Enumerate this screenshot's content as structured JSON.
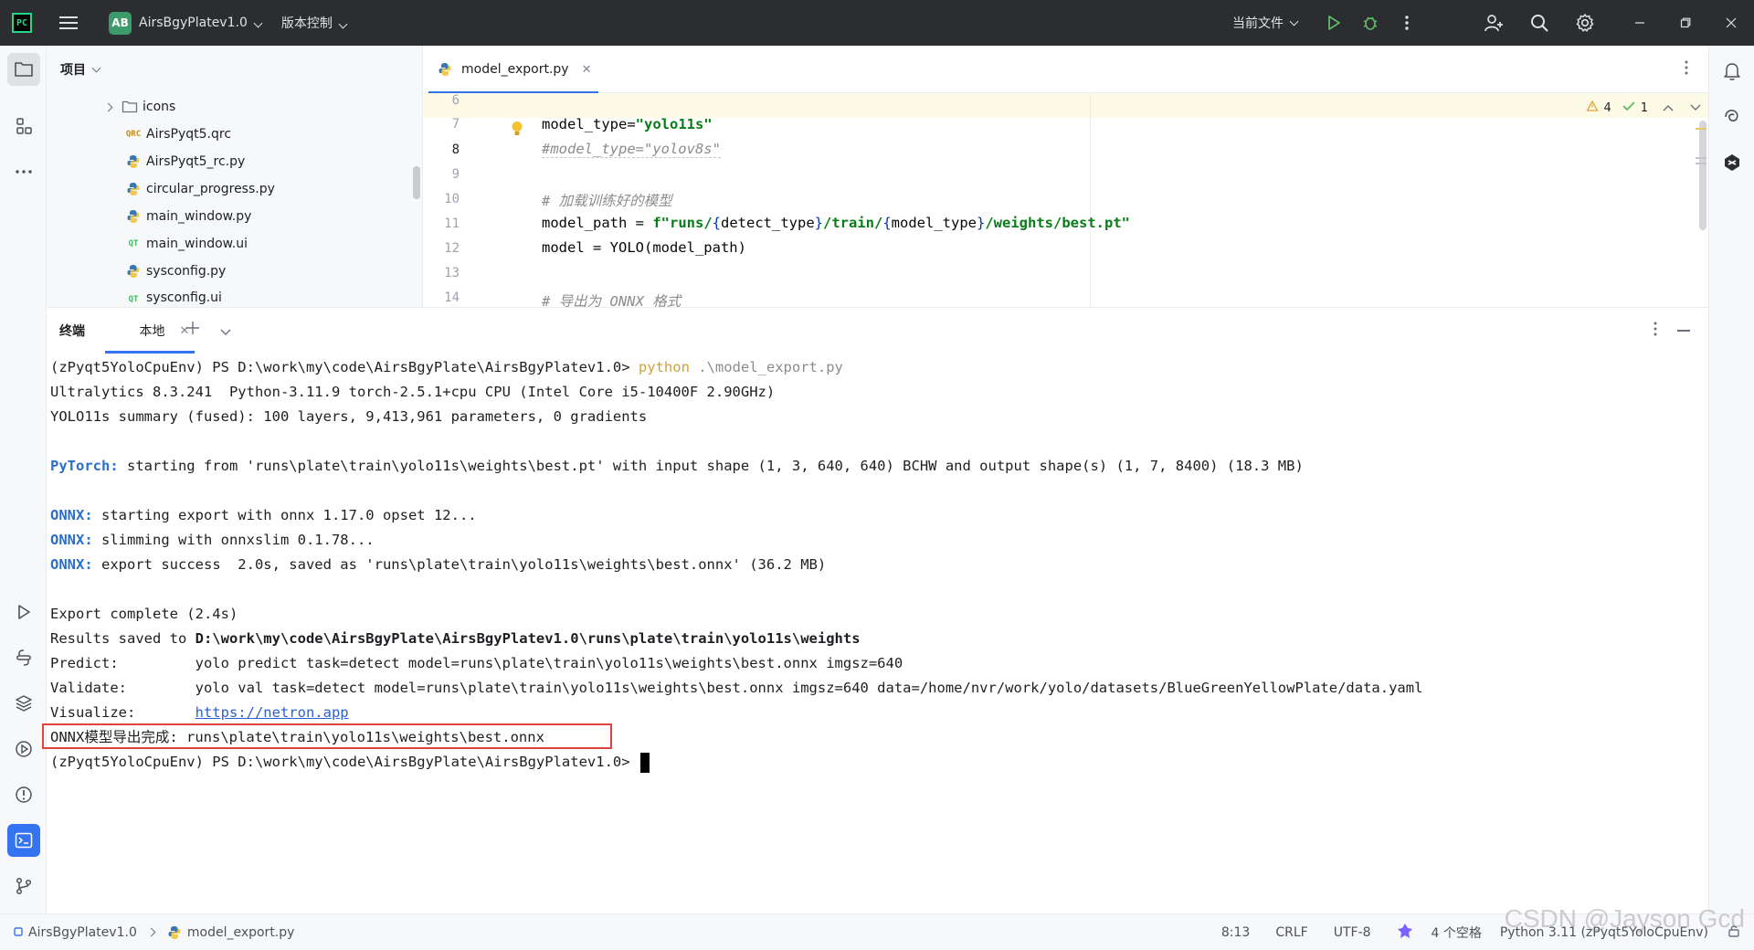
{
  "titlebar": {
    "project_badge": "AB",
    "project_name": "AirsBgyPlatev1.0",
    "vcs_label": "版本控制",
    "run_config": "当前文件"
  },
  "project_panel": {
    "title": "项目",
    "items": [
      {
        "label": "icons",
        "type": "folder"
      },
      {
        "label": "AirsPyqt5.qrc",
        "type": "qrc",
        "icon_text": "QRC"
      },
      {
        "label": "AirsPyqt5_rc.py",
        "type": "python"
      },
      {
        "label": "circular_progress.py",
        "type": "python"
      },
      {
        "label": "main_window.py",
        "type": "python"
      },
      {
        "label": "main_window.ui",
        "type": "qt",
        "icon_text": "QT"
      },
      {
        "label": "sysconfig.py",
        "type": "python"
      },
      {
        "label": "sysconfig.ui",
        "type": "qt",
        "icon_text": "QT"
      }
    ]
  },
  "editor": {
    "tab_label": "model_export.py",
    "warnings": "4",
    "checks": "1",
    "line_numbers": [
      "6",
      "7",
      "8",
      "9",
      "10",
      "11",
      "12",
      "13",
      "14"
    ],
    "lines": {
      "l7_a": "model_type=",
      "l7_b": "\"yolo11s\"",
      "l8": "#model_type=\"yolov8s\"",
      "l10": "# 加载训练好的模型",
      "l11_a": "model_path = ",
      "l11_b": "f\"runs/",
      "l11_c": "{",
      "l11_d": "detect_type",
      "l11_e": "}",
      "l11_f": "/train/",
      "l11_g": "{",
      "l11_h": "model_type",
      "l11_i": "}",
      "l11_j": "/weights/best.pt\"",
      "l12": "model = YOLO(model_path)",
      "l14": "# 导出为 ONNX 格式"
    }
  },
  "terminal": {
    "title": "终端",
    "tab_label": "本地",
    "lines": {
      "t1_prompt": "(zPyqt5YoloCpuEnv) PS D:\\work\\my\\code\\AirsBgyPlate\\AirsBgyPlatev1.0> ",
      "t1_cmd": "python",
      "t1_arg": " .\\model_export.py",
      "t2": "Ultralytics 8.3.241  Python-3.11.9 torch-2.5.1+cpu CPU (Intel Core i5-10400F 2.90GHz)",
      "t3": "YOLO11s summary (fused): 100 layers, 9,413,961 parameters, 0 gradients",
      "t5_lbl": "PyTorch:",
      "t5": " starting from 'runs\\plate\\train\\yolo11s\\weights\\best.pt' with input shape (1, 3, 640, 640) BCHW and output shape(s) (1, 7, 8400) (18.3 MB)",
      "t7_lbl": "ONNX:",
      "t7": " starting export with onnx 1.17.0 opset 12...",
      "t8_lbl": "ONNX:",
      "t8": " slimming with onnxslim 0.1.78...",
      "t9_lbl": "ONNX:",
      "t9": " export success  2.0s, saved as 'runs\\plate\\train\\yolo11s\\weights\\best.onnx' (36.2 MB)",
      "t11": "Export complete (2.4s)",
      "t12_a": "Results saved to ",
      "t12_b": "D:\\work\\my\\code\\AirsBgyPlate\\AirsBgyPlatev1.0\\runs\\plate\\train\\yolo11s\\weights",
      "t13": "Predict:         yolo predict task=detect model=runs\\plate\\train\\yolo11s\\weights\\best.onnx imgsz=640",
      "t14": "Validate:        yolo val task=detect model=runs\\plate\\train\\yolo11s\\weights\\best.onnx imgsz=640 data=/home/nvr/work/yolo/datasets/BlueGreenYellowPlate/data.yaml",
      "t15_a": "Visualize:       ",
      "t15_link": "https://netron.app",
      "t16": "ONNX模型导出完成: runs\\plate\\train\\yolo11s\\weights\\best.onnx",
      "t17_prompt": "(zPyqt5YoloCpuEnv) PS D:\\work\\my\\code\\AirsBgyPlate\\AirsBgyPlatev1.0> "
    }
  },
  "statusbar": {
    "project": "AirsBgyPlatev1.0",
    "file": "model_export.py",
    "position": "8:13",
    "line_sep": "CRLF",
    "encoding": "UTF-8",
    "indent": "4 个空格",
    "interpreter": "Python 3.11 (zPyqt5YoloCpuEnv)"
  },
  "watermark": "CSDN @Jayson Gcd",
  "colors": {
    "accent": "#3574f0",
    "highlight_box": "#e0433c",
    "string": "#067d17",
    "terminal_label": "#2a6fc9"
  }
}
